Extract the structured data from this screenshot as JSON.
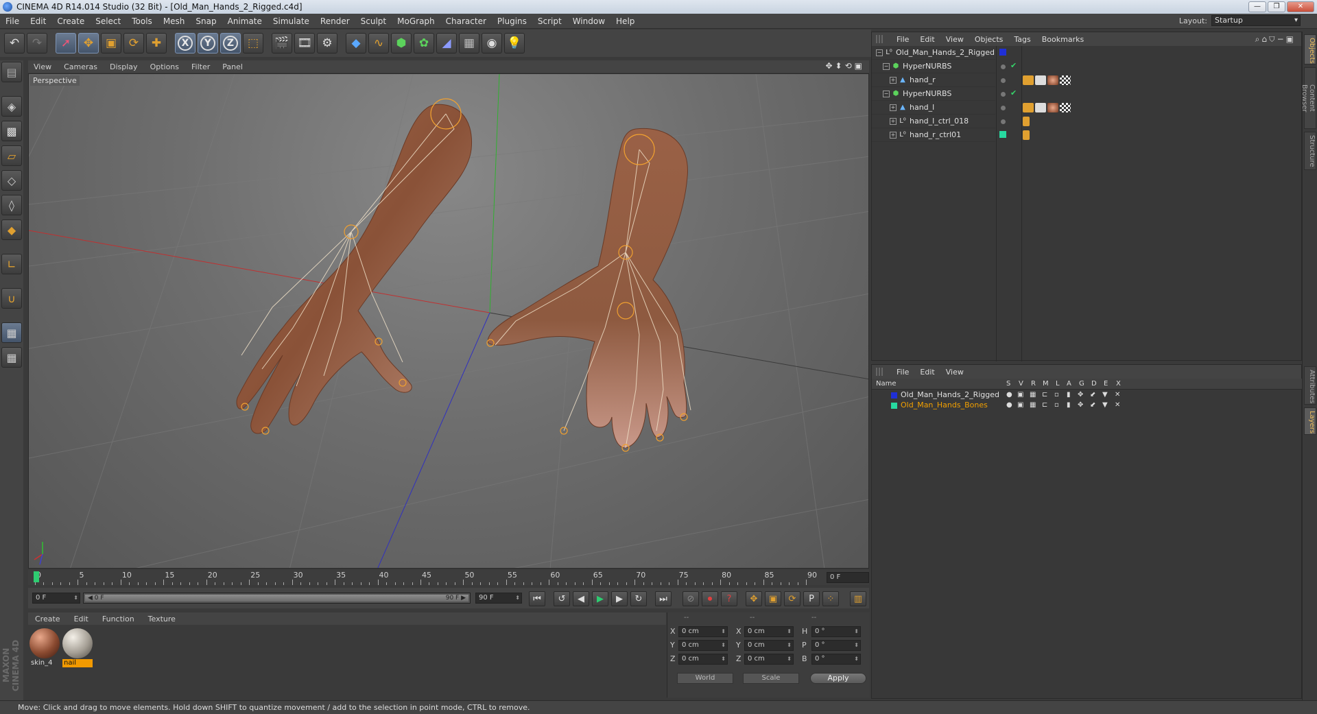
{
  "window": {
    "title": "CINEMA 4D R14.014 Studio (32 Bit) - [Old_Man_Hands_2_Rigged.c4d]",
    "buttons": [
      "—",
      "❐",
      "✕"
    ]
  },
  "menubar": {
    "items": [
      "File",
      "Edit",
      "Create",
      "Select",
      "Tools",
      "Mesh",
      "Snap",
      "Animate",
      "Simulate",
      "Render",
      "Sculpt",
      "MoGraph",
      "Character",
      "Plugins",
      "Script",
      "Window",
      "Help"
    ],
    "layout_label": "Layout:",
    "layout_value": "Startup"
  },
  "toolbar": {
    "axis_x": "X",
    "axis_y": "Y",
    "axis_z": "Z"
  },
  "viewport": {
    "menu": [
      "View",
      "Cameras",
      "Display",
      "Options",
      "Filter",
      "Panel"
    ],
    "camera_label": "Perspective",
    "nav_icons": "✥⬍⟲▣"
  },
  "timeline": {
    "ticks": [
      "0",
      "5",
      "10",
      "15",
      "20",
      "25",
      "30",
      "35",
      "40",
      "45",
      "50",
      "55",
      "60",
      "65",
      "70",
      "75",
      "80",
      "85",
      "90"
    ],
    "current_frame": "0 F"
  },
  "transport": {
    "start_field": "0 F",
    "range_start": "◀ 0 F",
    "range_end": "90 F ▶",
    "end_field": "90 F"
  },
  "materials": {
    "menu": [
      "Create",
      "Edit",
      "Function",
      "Texture"
    ],
    "items": [
      {
        "name": "skin_4",
        "selected": false
      },
      {
        "name": "nail",
        "selected": true
      }
    ]
  },
  "coordinates": {
    "headers": [
      "--",
      "--",
      "--"
    ],
    "rows": [
      {
        "a1": "X",
        "v1": "0 cm",
        "a2": "X",
        "v2": "0 cm",
        "a3": "H",
        "v3": "0 °"
      },
      {
        "a1": "Y",
        "v1": "0 cm",
        "a2": "Y",
        "v2": "0 cm",
        "a3": "P",
        "v3": "0 °"
      },
      {
        "a1": "Z",
        "v1": "0 cm",
        "a2": "Z",
        "v2": "0 cm",
        "a3": "B",
        "v3": "0 °"
      }
    ],
    "mode_select": "World",
    "scale_select": "Scale",
    "apply_label": "Apply"
  },
  "objects_panel": {
    "menu": [
      "File",
      "Edit",
      "View",
      "Objects",
      "Tags",
      "Bookmarks"
    ],
    "tree": [
      {
        "name": "Old_Man_Hands_2_Rigged",
        "depth": 0,
        "icon": "null"
      },
      {
        "name": "HyperNURBS",
        "depth": 1,
        "icon": "nurbs"
      },
      {
        "name": "hand_r",
        "depth": 2,
        "icon": "poly"
      },
      {
        "name": "HyperNURBS",
        "depth": 1,
        "icon": "nurbs"
      },
      {
        "name": "hand_l",
        "depth": 2,
        "icon": "poly"
      },
      {
        "name": "hand_l_ctrl_018",
        "depth": 1,
        "icon": "null"
      },
      {
        "name": "hand_r_ctrl01",
        "depth": 1,
        "icon": "null"
      }
    ]
  },
  "layers_panel": {
    "menu": [
      "File",
      "Edit",
      "View"
    ],
    "header_name": "Name",
    "header_cols": [
      "S",
      "V",
      "R",
      "M",
      "L",
      "A",
      "G",
      "D",
      "E",
      "X"
    ],
    "layers": [
      {
        "name": "Old_Man_Hands_2_Rigged",
        "color": "#1f2fd6"
      },
      {
        "name": "Old_Man_Hands_Bones",
        "color": "#27d9a0"
      }
    ]
  },
  "right_tabs": [
    "Objects",
    "Content Browser",
    "Structure",
    "Attributes",
    "Layers"
  ],
  "logo": {
    "text": "MAXON CINEMA 4D"
  },
  "status": {
    "text": "Move: Click and drag to move elements. Hold down SHIFT to quantize movement / add to the selection in point mode, CTRL to remove."
  },
  "colors": {
    "accent": "#f29a00",
    "selection_blue": "#5c7292",
    "play_green": "#2ecc71",
    "layer_orange": "#f2a000"
  }
}
